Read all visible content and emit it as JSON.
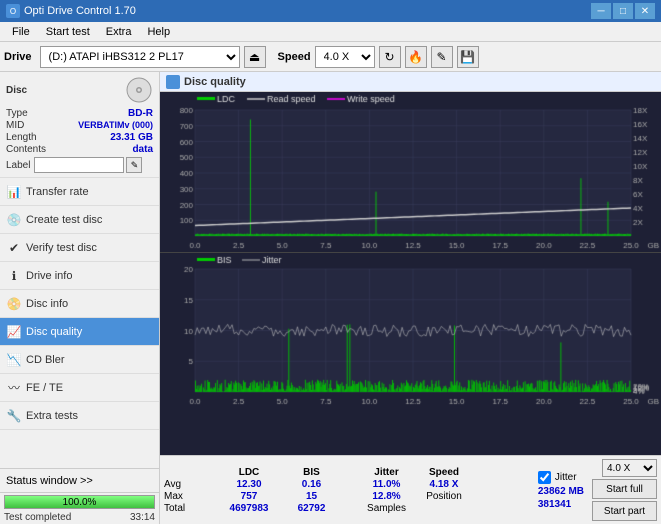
{
  "app": {
    "title": "Opti Drive Control 1.70",
    "icon": "disc-icon"
  },
  "title_bar": {
    "minimize": "─",
    "maximize": "□",
    "close": "✕"
  },
  "menu": {
    "items": [
      "File",
      "Start test",
      "Extra",
      "Help"
    ]
  },
  "toolbar": {
    "drive_label": "Drive",
    "drive_value": "(D:) ATAPI iHBS312  2 PL17",
    "speed_label": "Speed",
    "speed_value": "4.0 X"
  },
  "disc": {
    "type_label": "Type",
    "type_value": "BD-R",
    "mid_label": "MID",
    "mid_value": "VERBATIMv (000)",
    "length_label": "Length",
    "length_value": "23.31 GB",
    "contents_label": "Contents",
    "contents_value": "data",
    "label_label": "Label",
    "label_value": ""
  },
  "nav": {
    "items": [
      {
        "id": "transfer-rate",
        "label": "Transfer rate",
        "icon": "📊"
      },
      {
        "id": "create-test-disc",
        "label": "Create test disc",
        "icon": "💿"
      },
      {
        "id": "verify-test-disc",
        "label": "Verify test disc",
        "icon": "✔"
      },
      {
        "id": "drive-info",
        "label": "Drive info",
        "icon": "ℹ"
      },
      {
        "id": "disc-info",
        "label": "Disc info",
        "icon": "📀"
      },
      {
        "id": "disc-quality",
        "label": "Disc quality",
        "icon": "📈",
        "active": true
      },
      {
        "id": "cd-bler",
        "label": "CD Bler",
        "icon": "📉"
      },
      {
        "id": "fe-te",
        "label": "FE / TE",
        "icon": "〰"
      },
      {
        "id": "extra-tests",
        "label": "Extra tests",
        "icon": "🔧"
      }
    ]
  },
  "status_window": {
    "label": "Status window >>",
    "progress": 100,
    "progress_text": "100.0%",
    "status_text": "Test completed",
    "time": "33:14"
  },
  "disc_quality": {
    "title": "Disc quality",
    "chart_top": {
      "legend": [
        {
          "label": "LDC",
          "color": "#00ff00"
        },
        {
          "label": "Read speed",
          "color": "#ffffff"
        },
        {
          "label": "Write speed",
          "color": "#ff00ff"
        }
      ],
      "y_max": 800,
      "y_labels": [
        "800",
        "700",
        "600",
        "500",
        "400",
        "300",
        "200",
        "100"
      ],
      "y_right_labels": [
        "18X",
        "16X",
        "14X",
        "12X",
        "10X",
        "8X",
        "6X",
        "4X",
        "2X"
      ],
      "x_labels": [
        "0.0",
        "2.5",
        "5.0",
        "7.5",
        "10.0",
        "12.5",
        "15.0",
        "17.5",
        "20.0",
        "22.5",
        "25.0 GB"
      ]
    },
    "chart_bottom": {
      "legend": [
        {
          "label": "BIS",
          "color": "#00ff00"
        },
        {
          "label": "Jitter",
          "color": "#ffffff"
        }
      ],
      "y_max": 20,
      "y_labels": [
        "20",
        "15",
        "10",
        "5"
      ],
      "y_right_labels": [
        "20%",
        "16%",
        "12%",
        "8%",
        "4%"
      ],
      "x_labels": [
        "0.0",
        "2.5",
        "5.0",
        "7.5",
        "10.0",
        "12.5",
        "15.0",
        "17.5",
        "20.0",
        "22.5",
        "25.0 GB"
      ]
    }
  },
  "stats": {
    "columns": [
      "LDC",
      "BIS",
      "",
      "Jitter",
      "Speed"
    ],
    "avg_label": "Avg",
    "avg_ldc": "12.30",
    "avg_bis": "0.16",
    "avg_jitter": "11.0%",
    "avg_speed": "4.18 X",
    "max_label": "Max",
    "max_ldc": "757",
    "max_bis": "15",
    "max_jitter": "12.8%",
    "position_label": "Position",
    "position_value": "23862 MB",
    "total_label": "Total",
    "total_ldc": "4697983",
    "total_bis": "62792",
    "samples_label": "Samples",
    "samples_value": "381341",
    "speed_select": "4.0 X",
    "start_full": "Start full",
    "start_part": "Start part",
    "jitter_checked": true,
    "jitter_label": "Jitter"
  }
}
